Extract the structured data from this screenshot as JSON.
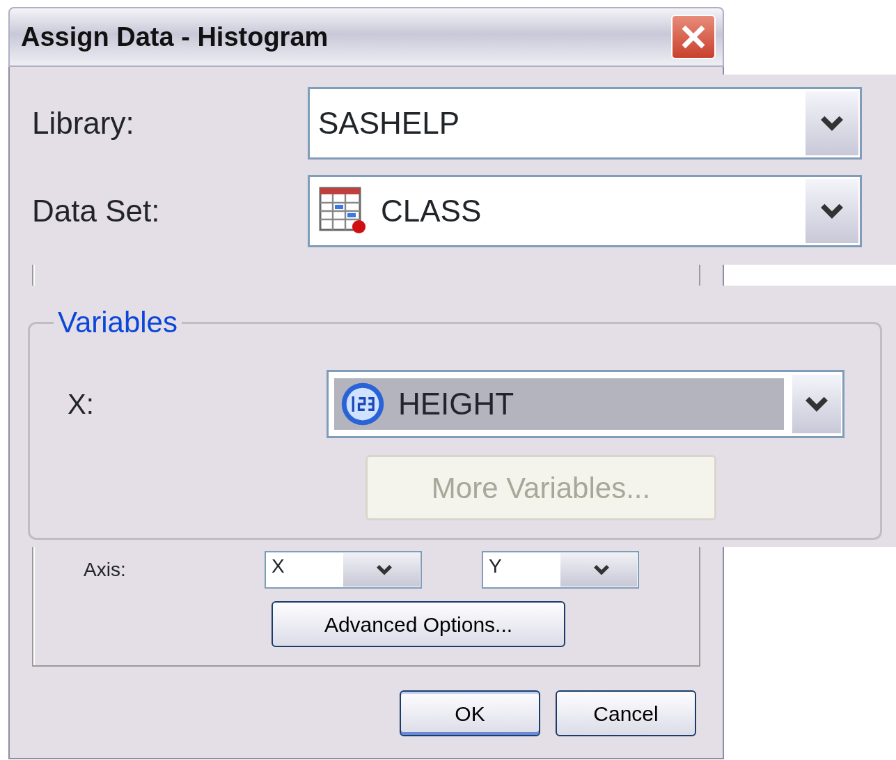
{
  "window": {
    "title": "Assign Data - Histogram"
  },
  "library": {
    "label": "Library:",
    "value": "SASHELP"
  },
  "data_set": {
    "label": "Data Set:",
    "value": "CLASS"
  },
  "variables": {
    "title": "Variables",
    "x": {
      "label": "X:",
      "value": "HEIGHT",
      "selected": true
    },
    "more_button": {
      "label": "More Variables...",
      "disabled": true
    }
  },
  "axis": {
    "label": "Axis:",
    "values": [
      "X",
      "Y"
    ]
  },
  "advanced_button": {
    "label": "Advanced Options..."
  },
  "buttons": [
    {
      "label": "OK",
      "default": true
    },
    {
      "label": "Cancel",
      "default": false
    }
  ]
}
